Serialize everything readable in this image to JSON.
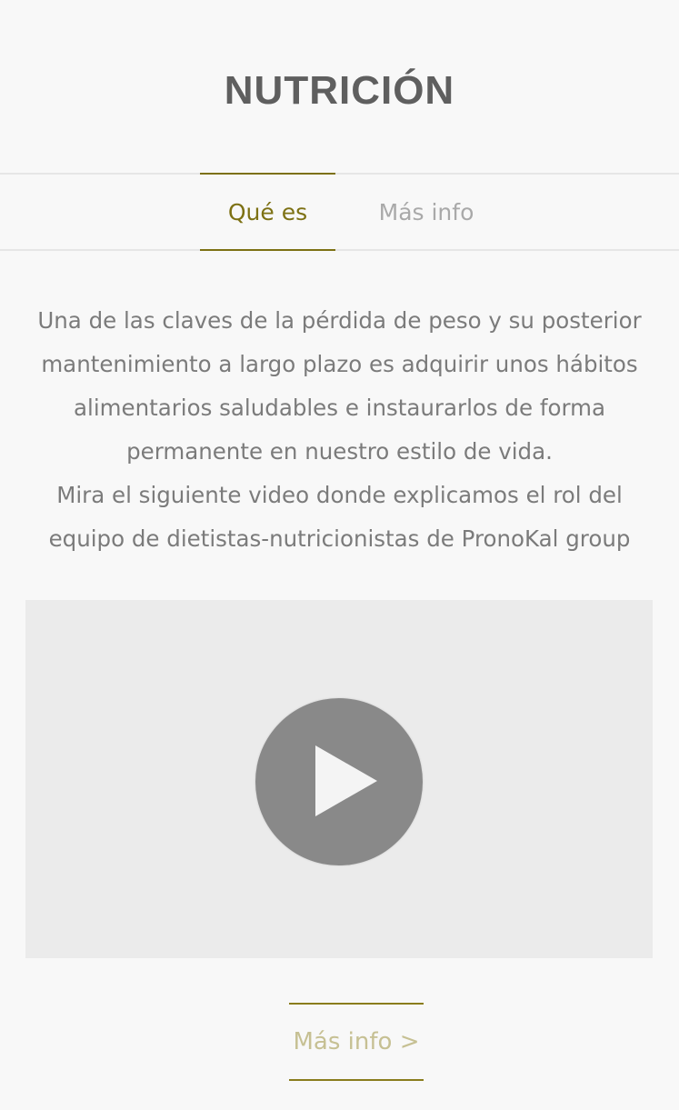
{
  "page": {
    "title": "NUTRICIÓN"
  },
  "tabs": [
    {
      "label": "Qué es",
      "active": true
    },
    {
      "label": "Más info",
      "active": false
    }
  ],
  "content": {
    "paragraph_1": "Una de las claves de la pérdida de peso y su posterior mantenimiento a largo plazo es adquirir unos hábitos alimentarios saludables e instaurarlos de forma permanente en nuestro estilo de vida.",
    "paragraph_2": "Mira el siguiente video donde explicamos el rol del equipo de dietistas-nutricionistas de PronoKal group"
  },
  "video": {
    "play_icon": "play-icon"
  },
  "more_link": {
    "label": "Más info >"
  },
  "colors": {
    "accent": "#7d7114",
    "muted_accent": "#c6c093",
    "title": "#5f5f5f",
    "text": "#7b7b7b",
    "background": "#f8f8f8"
  }
}
